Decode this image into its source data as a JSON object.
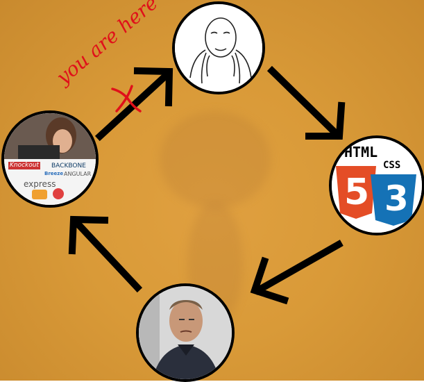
{
  "annotation": {
    "text": "you are here",
    "mark": "X"
  },
  "nodes": {
    "top": {
      "caption": ""
    },
    "left": {
      "logos": [
        "Knockout",
        "BACKBONE",
        "Breeze",
        "ANGULAR",
        "express"
      ]
    },
    "right": {
      "html_label": "HTML",
      "css_label": "CSS",
      "html_num": "5",
      "css_num": "3"
    },
    "bottom": {
      "caption": ""
    }
  },
  "icons": [
    "arrow-icon",
    "x-mark-icon",
    "html5-logo-icon",
    "css3-logo-icon"
  ],
  "colors": {
    "background": "#d99a38",
    "annotation": "#e0101a",
    "html5": "#e44d26",
    "css3": "#1572b6"
  }
}
